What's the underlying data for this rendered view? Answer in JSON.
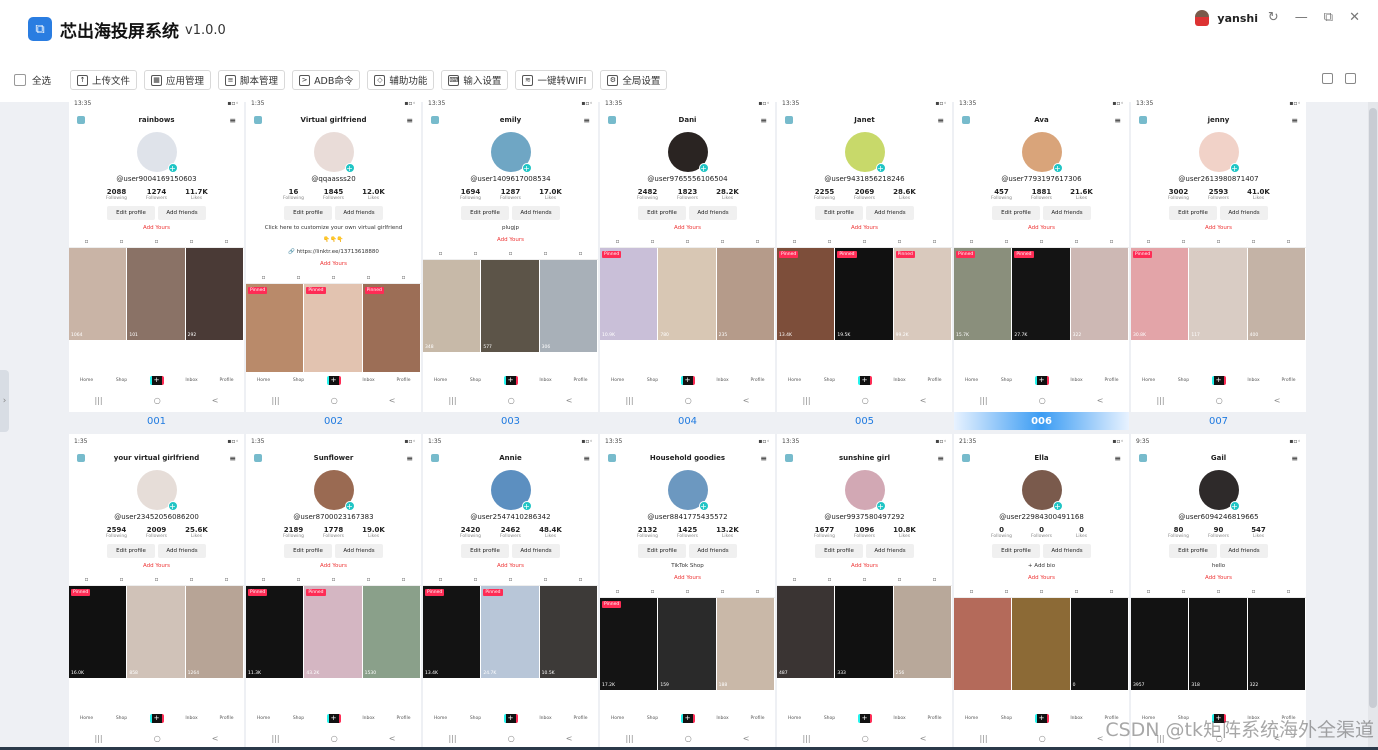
{
  "app": {
    "logo_glyph": "⧉",
    "title": "芯出海投屏系统",
    "version": "v1.0.0"
  },
  "user": {
    "name": "yanshi"
  },
  "window": {
    "refresh": "↻",
    "minimize": "—",
    "maximize": "⧉",
    "close": "✕"
  },
  "toolbar": {
    "select_all": "全选",
    "buttons": [
      {
        "label": "上传文件",
        "icon": "upload-icon",
        "glyph": "↑"
      },
      {
        "label": "应用管理",
        "icon": "apps-icon",
        "glyph": "▦"
      },
      {
        "label": "脚本管理",
        "icon": "script-icon",
        "glyph": "≡"
      },
      {
        "label": "ADB命令",
        "icon": "terminal-icon",
        "glyph": ">"
      },
      {
        "label": "辅助功能",
        "icon": "cube-icon",
        "glyph": "◇"
      },
      {
        "label": "输入设置",
        "icon": "keyboard-icon",
        "glyph": "⌨"
      },
      {
        "label": "一键转WIFI",
        "icon": "wifi-icon",
        "glyph": "≋"
      },
      {
        "label": "全局设置",
        "icon": "gear-icon",
        "glyph": "⚙"
      }
    ]
  },
  "profile_labels": {
    "following": "Following",
    "followers": "Followers",
    "likes": "Likes",
    "edit": "Edit profile",
    "add": "Add friends",
    "add_yours": "Add Yours",
    "pinned": "Pinned"
  },
  "nav_labels": [
    "Home",
    "Shop",
    "+",
    "Inbox",
    "Profile"
  ],
  "sysnav": [
    "|||",
    "○",
    "<"
  ],
  "devices": [
    {
      "label": "001",
      "time": "13:35",
      "name": "rainbows",
      "handle": "@user9004169150603",
      "following": "2088",
      "followers": "1274",
      "likes": "11.7K",
      "bio": [],
      "add_yours": "Add Yours",
      "avatar": "#dfe3ea",
      "videos": [
        {
          "pin": "",
          "views": "1064",
          "color": "#c9b4a6"
        },
        {
          "pin": "",
          "views": "101",
          "color": "#8a7266"
        },
        {
          "pin": "",
          "views": "292",
          "color": "#4a3a36"
        }
      ],
      "active": false
    },
    {
      "label": "002",
      "time": "1:35",
      "name": "Virtual girlfriend",
      "handle": "@qqaasss20",
      "following": "16",
      "followers": "1845",
      "likes": "12.0K",
      "bio": [
        "Click here to customize your own virtual girlfriend",
        "👇👇👇",
        "🔗 https://linktr.ee/13713618880"
      ],
      "add_yours": "Add Yours",
      "avatar": "#e9dcd8",
      "videos": [
        {
          "pin": "Pinned",
          "views": "",
          "color": "#b98a6a"
        },
        {
          "pin": "Pinned",
          "views": "",
          "color": "#e2c3b0"
        },
        {
          "pin": "Pinned",
          "views": "",
          "color": "#9c6e56"
        }
      ],
      "active": false
    },
    {
      "label": "003",
      "time": "13:35",
      "name": "emily",
      "handle": "@user1409617008534",
      "following": "1694",
      "followers": "1287",
      "likes": "17.0K",
      "bio": [
        "plugjp"
      ],
      "add_yours": "Add Yours",
      "avatar": "#6fa6c4",
      "videos": [
        {
          "pin": "",
          "views": "348",
          "color": "#c7b9a8"
        },
        {
          "pin": "",
          "views": "577",
          "color": "#5c5448"
        },
        {
          "pin": "",
          "views": "306",
          "color": "#a8b0b8"
        }
      ],
      "active": false
    },
    {
      "label": "004",
      "time": "13:35",
      "name": "Dani",
      "handle": "@user9765556106504",
      "following": "2482",
      "followers": "1823",
      "likes": "28.2K",
      "bio": [],
      "add_yours": "Add Yours",
      "avatar": "#2a2422",
      "videos": [
        {
          "pin": "Pinned",
          "views": "10.9K",
          "color": "#c9bfd8"
        },
        {
          "pin": "",
          "views": "780",
          "color": "#d8c7b4"
        },
        {
          "pin": "",
          "views": "235",
          "color": "#b59b8a"
        }
      ],
      "active": false
    },
    {
      "label": "005",
      "time": "13:35",
      "name": "Janet",
      "handle": "@user9431856218246",
      "following": "2255",
      "followers": "2069",
      "likes": "28.6K",
      "bio": [],
      "add_yours": "Add Yours",
      "avatar": "#c8d96a",
      "videos": [
        {
          "pin": "Pinned",
          "views": "13.4K",
          "color": "#7d4e3a"
        },
        {
          "pin": "Pinned",
          "views": "19.5K",
          "color": "#111111"
        },
        {
          "pin": "Pinned",
          "views": "99.2K",
          "color": "#d9c9bd"
        }
      ],
      "active": false
    },
    {
      "label": "006",
      "time": "13:35",
      "name": "Ava",
      "handle": "@user7793197617306",
      "following": "457",
      "followers": "1881",
      "likes": "21.6K",
      "bio": [],
      "add_yours": "Add Yours",
      "avatar": "#d9a47a",
      "videos": [
        {
          "pin": "Pinned",
          "views": "15.7K",
          "color": "#8a8f7c"
        },
        {
          "pin": "Pinned",
          "views": "27.7K",
          "color": "#141414"
        },
        {
          "pin": "",
          "views": "322",
          "color": "#cdb8b4"
        }
      ],
      "active": true
    },
    {
      "label": "007",
      "time": "13:35",
      "name": "jenny",
      "handle": "@user2613980871407",
      "following": "3002",
      "followers": "2593",
      "likes": "41.0K",
      "bio": [],
      "add_yours": "Add Yours",
      "avatar": "#f1d2c8",
      "videos": [
        {
          "pin": "Pinned",
          "views": "30.8K",
          "color": "#e3a4a8"
        },
        {
          "pin": "",
          "views": "117",
          "color": "#d9ccc4"
        },
        {
          "pin": "",
          "views": "400",
          "color": "#c4b3a6"
        }
      ],
      "active": false
    },
    {
      "label": "",
      "time": "1:35",
      "name": "your virtual girlfriend",
      "handle": "@user23452056086200",
      "following": "2594",
      "followers": "2009",
      "likes": "25.6K",
      "bio": [],
      "add_yours": "Add Yours",
      "avatar": "#e6ddd8",
      "videos": [
        {
          "pin": "Pinned",
          "views": "16.0K",
          "color": "#111111"
        },
        {
          "pin": "",
          "views": "858",
          "color": "#d0c2b8"
        },
        {
          "pin": "",
          "views": "1264",
          "color": "#b7a496"
        }
      ],
      "active": false
    },
    {
      "label": "",
      "time": "1:35",
      "name": "Sunflower",
      "handle": "@user8700023167383",
      "following": "2189",
      "followers": "1778",
      "likes": "19.0K",
      "bio": [],
      "add_yours": "Add Yours",
      "avatar": "#9a6a52",
      "videos": [
        {
          "pin": "Pinned",
          "views": "11.3K",
          "color": "#121212"
        },
        {
          "pin": "Pinned",
          "views": "43.2K",
          "color": "#d4b6c2"
        },
        {
          "pin": "",
          "views": "1530",
          "color": "#8aa08a"
        }
      ],
      "active": false
    },
    {
      "label": "",
      "time": "1:35",
      "name": "Annie",
      "handle": "@user2547410286342",
      "following": "2420",
      "followers": "2462",
      "likes": "48.4K",
      "bio": [],
      "add_yours": "Add Yours",
      "avatar": "#5c8fc0",
      "videos": [
        {
          "pin": "Pinned",
          "views": "13.4K",
          "color": "#131313"
        },
        {
          "pin": "Pinned",
          "views": "24.7K",
          "color": "#b8c6d8"
        },
        {
          "pin": "",
          "views": "10.5K",
          "color": "#3d3a38"
        }
      ],
      "active": false
    },
    {
      "label": "",
      "time": "13:35",
      "name": "Household goodies",
      "handle": "@user8841775435572",
      "following": "2132",
      "followers": "1425",
      "likes": "13.2K",
      "bio": [
        "TikTok Shop"
      ],
      "add_yours": "Add Yours",
      "avatar": "#6c98c0",
      "videos": [
        {
          "pin": "Pinned",
          "views": "17.2K",
          "color": "#141414"
        },
        {
          "pin": "",
          "views": "159",
          "color": "#2a2a2a"
        },
        {
          "pin": "",
          "views": "188",
          "color": "#c9b8a8"
        }
      ],
      "active": false
    },
    {
      "label": "",
      "time": "13:35",
      "name": "sunshine girl",
      "handle": "@user9937580497292",
      "following": "1677",
      "followers": "1096",
      "likes": "10.8K",
      "bio": [],
      "add_yours": "Add Yours",
      "avatar": "#d2a8b4",
      "videos": [
        {
          "pin": "",
          "views": "487",
          "color": "#3a3433"
        },
        {
          "pin": "",
          "views": "333",
          "color": "#111111"
        },
        {
          "pin": "",
          "views": "256",
          "color": "#b8a89a"
        }
      ],
      "active": false
    },
    {
      "label": "",
      "time": "21:35",
      "name": "Ella",
      "handle": "@user22984300491168",
      "following": "0",
      "followers": "0",
      "likes": "0",
      "bio": [
        "+ Add bio"
      ],
      "add_yours": "Add Yours",
      "avatar": "#7a5a4c",
      "videos": [
        {
          "pin": "",
          "views": "",
          "color": "#b46a5a"
        },
        {
          "pin": "",
          "views": "",
          "color": "#8c6a36"
        },
        {
          "pin": "",
          "views": "0",
          "color": "#141414"
        }
      ],
      "active": false
    },
    {
      "label": "",
      "time": "9:35",
      "name": "Gail",
      "handle": "@user6094246819665",
      "following": "80",
      "followers": "90",
      "likes": "547",
      "bio": [
        "hello"
      ],
      "add_yours": "Add Yours",
      "avatar": "#2e2a2a",
      "videos": [
        {
          "pin": "",
          "views": "3957",
          "color": "#121212"
        },
        {
          "pin": "",
          "views": "318",
          "color": "#131313"
        },
        {
          "pin": "",
          "views": "322",
          "color": "#141414"
        }
      ],
      "active": false
    }
  ],
  "watermark": "CSDN @tk矩阵系统海外全渠道"
}
